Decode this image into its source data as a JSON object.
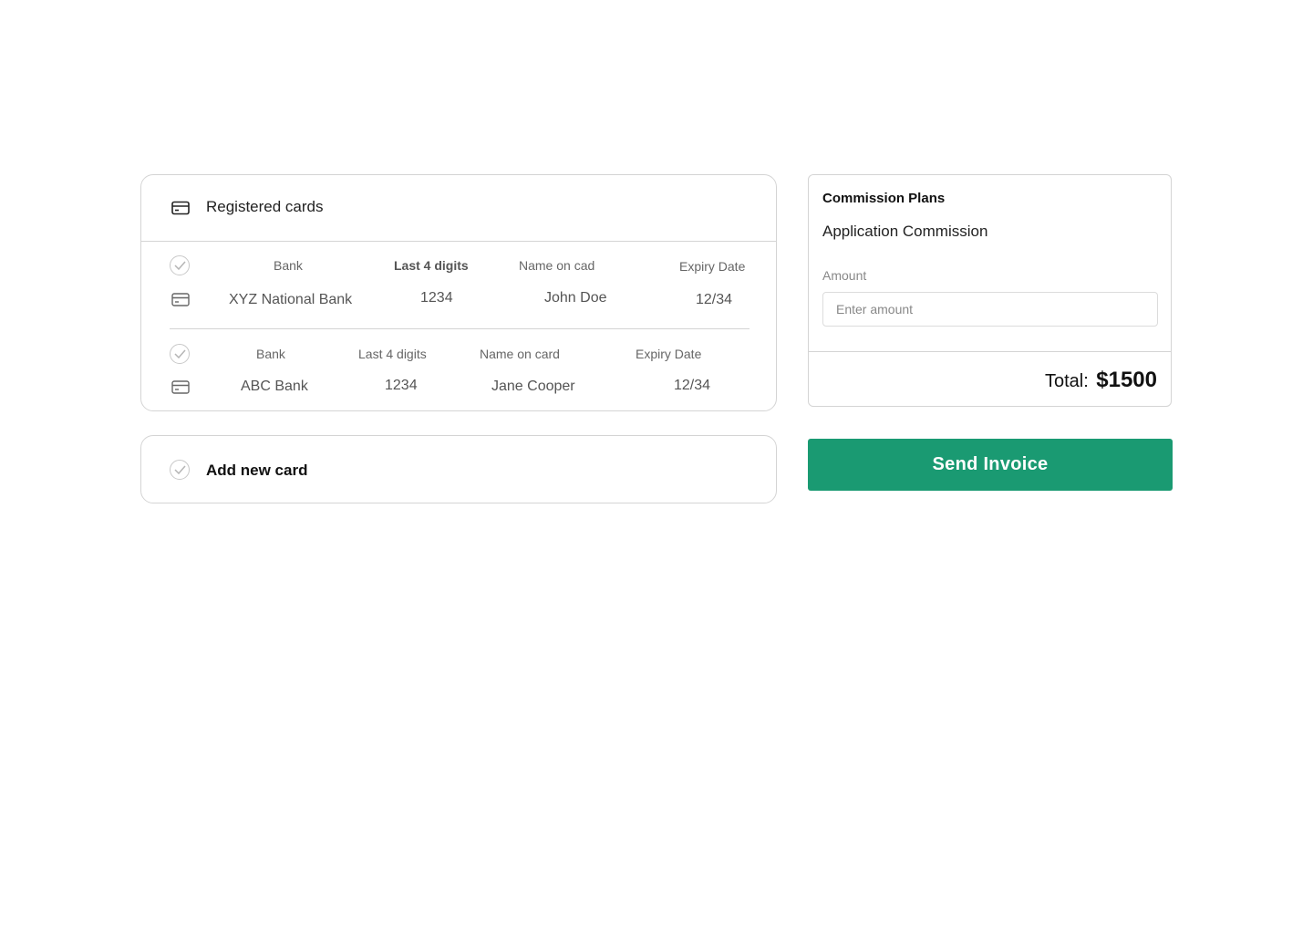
{
  "cards_panel": {
    "title": "Registered cards",
    "header_icon": "credit-card-icon",
    "cards": [
      {
        "labels": {
          "bank": "Bank",
          "last4": "Last 4 digits",
          "name": "Name on cad",
          "expiry": "Expiry Date"
        },
        "bank": "XYZ National Bank",
        "last4": "1234",
        "name": "John Doe",
        "expiry": "12/34"
      },
      {
        "labels": {
          "bank": "Bank",
          "last4": "Last 4 digits",
          "name": "Name on card",
          "expiry": "Expiry Date"
        },
        "bank": "ABC Bank",
        "last4": "1234",
        "name": "Jane Cooper",
        "expiry": "12/34"
      }
    ]
  },
  "add_card": {
    "label": "Add new card"
  },
  "commission": {
    "title": "Commission Plans",
    "plan": "Application Commission",
    "amount_label": "Amount",
    "amount_placeholder": "Enter amount",
    "amount_value": "",
    "total_label": "Total:",
    "total_value": "$1500"
  },
  "send_button": {
    "label": "Send Invoice"
  },
  "colors": {
    "primary": "#1a9a72",
    "border": "#d4d4d4",
    "check": "#c8c8c8"
  }
}
